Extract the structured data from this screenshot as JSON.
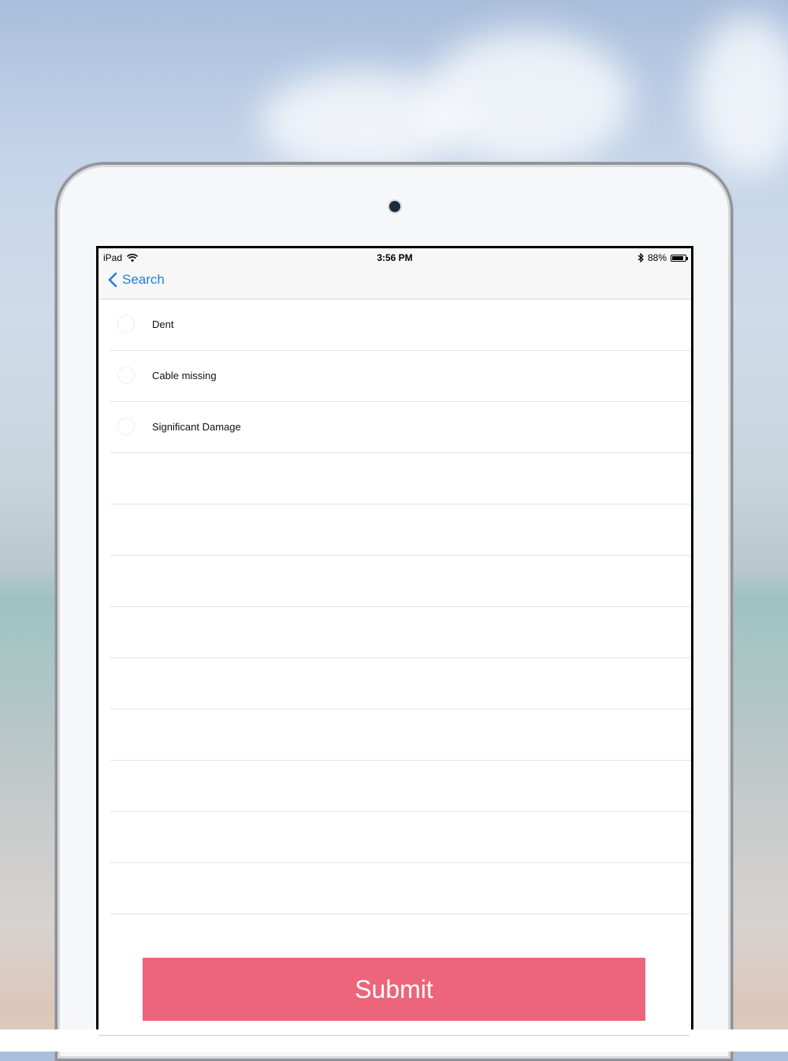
{
  "status_bar": {
    "device": "iPad",
    "time": "3:56 PM",
    "battery_text": "88%",
    "battery_level": 0.88
  },
  "nav": {
    "back_label": "Search"
  },
  "items": [
    {
      "label": "Dent"
    },
    {
      "label": "Cable missing"
    },
    {
      "label": "Significant Damage"
    },
    {
      "label": ""
    },
    {
      "label": ""
    },
    {
      "label": ""
    },
    {
      "label": ""
    },
    {
      "label": ""
    },
    {
      "label": ""
    },
    {
      "label": ""
    },
    {
      "label": ""
    },
    {
      "label": ""
    }
  ],
  "submit_label": "Submit",
  "colors": {
    "accent": "#1f7fd9",
    "submit": "#ec657b"
  }
}
